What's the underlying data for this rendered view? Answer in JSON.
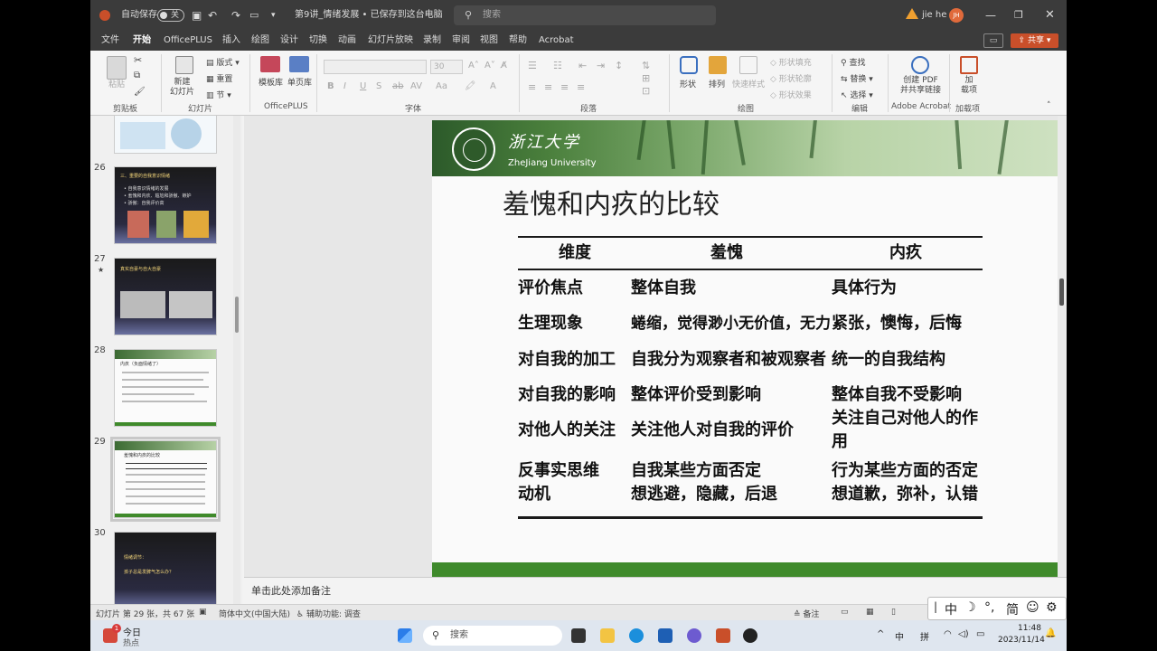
{
  "titlebar": {
    "autosave_label": "自动保存",
    "autosave_state": "关",
    "doc_title": "第9讲_情绪发展 • 已保存到这台电脑",
    "search_placeholder": "搜索",
    "user_name": "jie he",
    "user_initials": "JH"
  },
  "menubar": {
    "tabs": [
      "文件",
      "开始",
      "OfficePLUS",
      "插入",
      "绘图",
      "设计",
      "切换",
      "动画",
      "幻灯片放映",
      "录制",
      "审阅",
      "视图",
      "帮助",
      "Acrobat"
    ],
    "active_tab": "开始",
    "share_label": "共享"
  },
  "ribbon": {
    "clipboard": {
      "paste": "粘贴",
      "group": "剪贴板"
    },
    "slides": {
      "new_slide": "新建\n幻灯片",
      "layout": "版式",
      "reset": "重置",
      "section": "节",
      "group": "幻灯片"
    },
    "officeplus": {
      "template": "模板库",
      "single": "单页库",
      "group": "OfficePLUS"
    },
    "font": {
      "size": "30",
      "group": "字体"
    },
    "paragraph": {
      "group": "段落"
    },
    "drawing": {
      "shapes": "形状",
      "arrange": "排列",
      "quick_styles": "快速样式",
      "fill": "形状填充",
      "outline": "形状轮廓",
      "effects": "形状效果",
      "group": "绘图"
    },
    "editing": {
      "find": "查找",
      "replace": "替换",
      "select": "选择",
      "group": "编辑"
    },
    "acrobat": {
      "create_pdf": "创建 PDF\n并共享链接",
      "group": "Adobe Acrobat"
    },
    "addins": {
      "load": "加\n载项",
      "group": "加载项"
    }
  },
  "thumbnails": [
    {
      "num": "26",
      "title": "三、重要的自我意识情绪",
      "line1": "• 自我意识情绪的发展",
      "line2": "• 羞愧和内疚、尴尬和骄傲、嫉妒",
      "line3": "• 骄傲：自我评价高"
    },
    {
      "num": "27",
      "title": "真实自豪与自大自豪"
    },
    {
      "num": "28",
      "title": "内疚（负面情绪了）"
    },
    {
      "num": "29",
      "title": "羞愧和内疚的比较"
    },
    {
      "num": "30",
      "title": "情绪调节：",
      "line1": "孩子总是发脾气怎么办？"
    }
  ],
  "slide": {
    "logo_cn": "浙江大学",
    "logo_en": "ZheJiang University",
    "title": "羞愧和内疚的比较",
    "table": {
      "headers": [
        "维度",
        "羞愧",
        "内疚"
      ],
      "rows": [
        [
          "评价焦点",
          "整体自我",
          "具体行为"
        ],
        [
          "生理现象",
          "蜷缩，觉得渺小无价值，无力",
          "紧张，懊悔，后悔"
        ],
        [
          "对自我的加工",
          "自我分为观察者和被观察者",
          "统一的自我结构"
        ],
        [
          "对自我的影响",
          "整体评价受到影响",
          "整体自我不受影响"
        ],
        [
          "对他人的关注",
          "关注他人对自我的评价",
          "关注自己对他人的作用"
        ],
        [
          "反事实思维动机",
          "自我某些方面否定\n想逃避，隐藏，后退",
          "行为某些方面的否定\n想道歉，弥补，认错"
        ]
      ]
    }
  },
  "notes_placeholder": "单击此处添加备注",
  "statusbar": {
    "slide_info": "幻灯片 第 29 张，共 67 张",
    "language": "简体中文(中国大陆)",
    "accessibility": "辅助功能: 调查",
    "notes_btn": "备注"
  },
  "ime": {
    "lang": "中",
    "simp": "简"
  },
  "taskbar": {
    "widget_title": "今日",
    "widget_sub": "热点",
    "widget_badge": "1",
    "search_placeholder": "搜索",
    "tray_lang": "中",
    "tray_ime": "拼",
    "time": "11:48",
    "date": "2023/11/14"
  },
  "colors": {
    "accent": "#c94f2a",
    "slide_footer": "#3f8a2b"
  }
}
